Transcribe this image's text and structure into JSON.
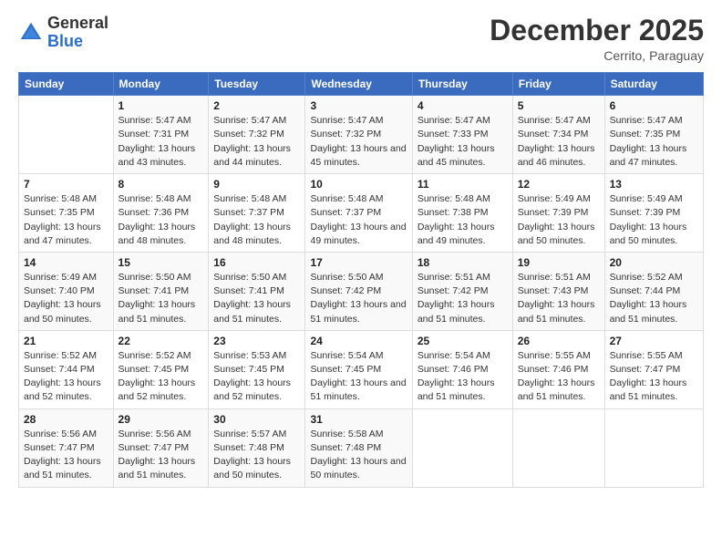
{
  "header": {
    "logo_general": "General",
    "logo_blue": "Blue",
    "month": "December 2025",
    "location": "Cerrito, Paraguay"
  },
  "days_of_week": [
    "Sunday",
    "Monday",
    "Tuesday",
    "Wednesday",
    "Thursday",
    "Friday",
    "Saturday"
  ],
  "weeks": [
    [
      {
        "num": "",
        "sunrise": "",
        "sunset": "",
        "daylight": ""
      },
      {
        "num": "1",
        "sunrise": "Sunrise: 5:47 AM",
        "sunset": "Sunset: 7:31 PM",
        "daylight": "Daylight: 13 hours and 43 minutes."
      },
      {
        "num": "2",
        "sunrise": "Sunrise: 5:47 AM",
        "sunset": "Sunset: 7:32 PM",
        "daylight": "Daylight: 13 hours and 44 minutes."
      },
      {
        "num": "3",
        "sunrise": "Sunrise: 5:47 AM",
        "sunset": "Sunset: 7:32 PM",
        "daylight": "Daylight: 13 hours and 45 minutes."
      },
      {
        "num": "4",
        "sunrise": "Sunrise: 5:47 AM",
        "sunset": "Sunset: 7:33 PM",
        "daylight": "Daylight: 13 hours and 45 minutes."
      },
      {
        "num": "5",
        "sunrise": "Sunrise: 5:47 AM",
        "sunset": "Sunset: 7:34 PM",
        "daylight": "Daylight: 13 hours and 46 minutes."
      },
      {
        "num": "6",
        "sunrise": "Sunrise: 5:47 AM",
        "sunset": "Sunset: 7:35 PM",
        "daylight": "Daylight: 13 hours and 47 minutes."
      }
    ],
    [
      {
        "num": "7",
        "sunrise": "Sunrise: 5:48 AM",
        "sunset": "Sunset: 7:35 PM",
        "daylight": "Daylight: 13 hours and 47 minutes."
      },
      {
        "num": "8",
        "sunrise": "Sunrise: 5:48 AM",
        "sunset": "Sunset: 7:36 PM",
        "daylight": "Daylight: 13 hours and 48 minutes."
      },
      {
        "num": "9",
        "sunrise": "Sunrise: 5:48 AM",
        "sunset": "Sunset: 7:37 PM",
        "daylight": "Daylight: 13 hours and 48 minutes."
      },
      {
        "num": "10",
        "sunrise": "Sunrise: 5:48 AM",
        "sunset": "Sunset: 7:37 PM",
        "daylight": "Daylight: 13 hours and 49 minutes."
      },
      {
        "num": "11",
        "sunrise": "Sunrise: 5:48 AM",
        "sunset": "Sunset: 7:38 PM",
        "daylight": "Daylight: 13 hours and 49 minutes."
      },
      {
        "num": "12",
        "sunrise": "Sunrise: 5:49 AM",
        "sunset": "Sunset: 7:39 PM",
        "daylight": "Daylight: 13 hours and 50 minutes."
      },
      {
        "num": "13",
        "sunrise": "Sunrise: 5:49 AM",
        "sunset": "Sunset: 7:39 PM",
        "daylight": "Daylight: 13 hours and 50 minutes."
      }
    ],
    [
      {
        "num": "14",
        "sunrise": "Sunrise: 5:49 AM",
        "sunset": "Sunset: 7:40 PM",
        "daylight": "Daylight: 13 hours and 50 minutes."
      },
      {
        "num": "15",
        "sunrise": "Sunrise: 5:50 AM",
        "sunset": "Sunset: 7:41 PM",
        "daylight": "Daylight: 13 hours and 51 minutes."
      },
      {
        "num": "16",
        "sunrise": "Sunrise: 5:50 AM",
        "sunset": "Sunset: 7:41 PM",
        "daylight": "Daylight: 13 hours and 51 minutes."
      },
      {
        "num": "17",
        "sunrise": "Sunrise: 5:50 AM",
        "sunset": "Sunset: 7:42 PM",
        "daylight": "Daylight: 13 hours and 51 minutes."
      },
      {
        "num": "18",
        "sunrise": "Sunrise: 5:51 AM",
        "sunset": "Sunset: 7:42 PM",
        "daylight": "Daylight: 13 hours and 51 minutes."
      },
      {
        "num": "19",
        "sunrise": "Sunrise: 5:51 AM",
        "sunset": "Sunset: 7:43 PM",
        "daylight": "Daylight: 13 hours and 51 minutes."
      },
      {
        "num": "20",
        "sunrise": "Sunrise: 5:52 AM",
        "sunset": "Sunset: 7:44 PM",
        "daylight": "Daylight: 13 hours and 51 minutes."
      }
    ],
    [
      {
        "num": "21",
        "sunrise": "Sunrise: 5:52 AM",
        "sunset": "Sunset: 7:44 PM",
        "daylight": "Daylight: 13 hours and 52 minutes."
      },
      {
        "num": "22",
        "sunrise": "Sunrise: 5:52 AM",
        "sunset": "Sunset: 7:45 PM",
        "daylight": "Daylight: 13 hours and 52 minutes."
      },
      {
        "num": "23",
        "sunrise": "Sunrise: 5:53 AM",
        "sunset": "Sunset: 7:45 PM",
        "daylight": "Daylight: 13 hours and 52 minutes."
      },
      {
        "num": "24",
        "sunrise": "Sunrise: 5:54 AM",
        "sunset": "Sunset: 7:45 PM",
        "daylight": "Daylight: 13 hours and 51 minutes."
      },
      {
        "num": "25",
        "sunrise": "Sunrise: 5:54 AM",
        "sunset": "Sunset: 7:46 PM",
        "daylight": "Daylight: 13 hours and 51 minutes."
      },
      {
        "num": "26",
        "sunrise": "Sunrise: 5:55 AM",
        "sunset": "Sunset: 7:46 PM",
        "daylight": "Daylight: 13 hours and 51 minutes."
      },
      {
        "num": "27",
        "sunrise": "Sunrise: 5:55 AM",
        "sunset": "Sunset: 7:47 PM",
        "daylight": "Daylight: 13 hours and 51 minutes."
      }
    ],
    [
      {
        "num": "28",
        "sunrise": "Sunrise: 5:56 AM",
        "sunset": "Sunset: 7:47 PM",
        "daylight": "Daylight: 13 hours and 51 minutes."
      },
      {
        "num": "29",
        "sunrise": "Sunrise: 5:56 AM",
        "sunset": "Sunset: 7:47 PM",
        "daylight": "Daylight: 13 hours and 51 minutes."
      },
      {
        "num": "30",
        "sunrise": "Sunrise: 5:57 AM",
        "sunset": "Sunset: 7:48 PM",
        "daylight": "Daylight: 13 hours and 50 minutes."
      },
      {
        "num": "31",
        "sunrise": "Sunrise: 5:58 AM",
        "sunset": "Sunset: 7:48 PM",
        "daylight": "Daylight: 13 hours and 50 minutes."
      },
      {
        "num": "",
        "sunrise": "",
        "sunset": "",
        "daylight": ""
      },
      {
        "num": "",
        "sunrise": "",
        "sunset": "",
        "daylight": ""
      },
      {
        "num": "",
        "sunrise": "",
        "sunset": "",
        "daylight": ""
      }
    ]
  ]
}
